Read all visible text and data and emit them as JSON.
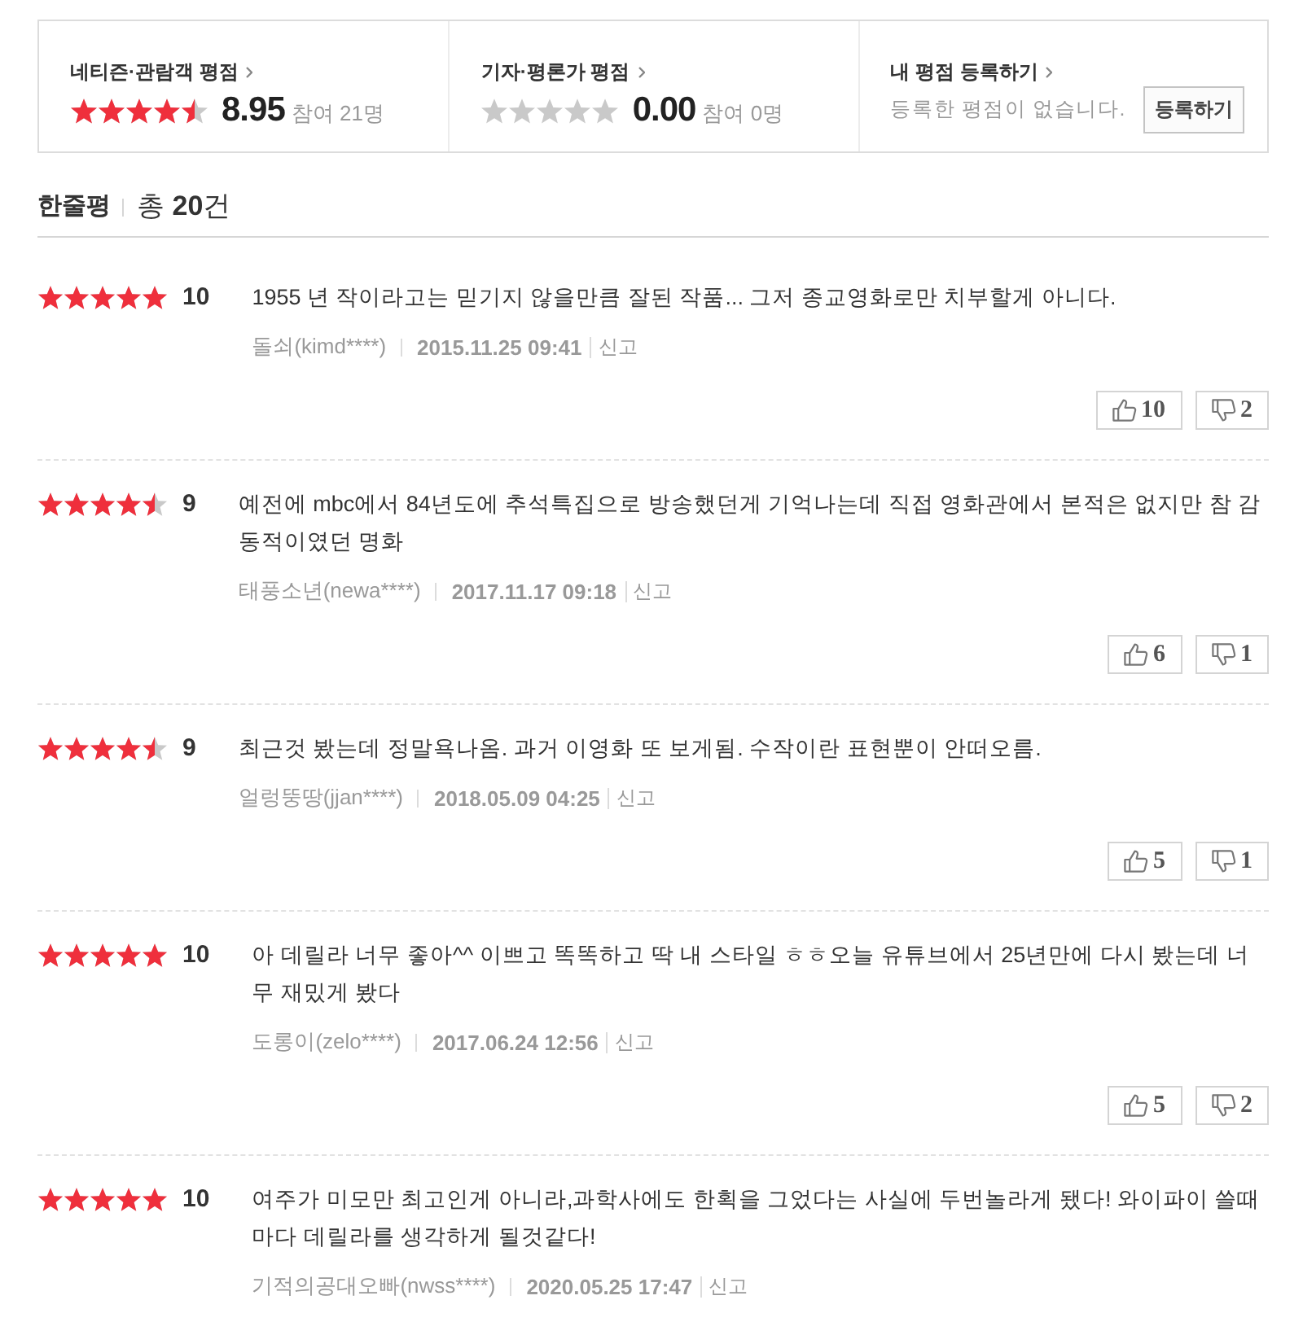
{
  "rating_summary": {
    "sections": [
      {
        "kind": "rating",
        "title": "네티즌·관람객 평점",
        "stars": 4.5,
        "score": "8.95",
        "participants": "참여 21명"
      },
      {
        "kind": "rating",
        "title": "기자·평론가 평점",
        "stars": 0,
        "score": "0.00",
        "participants": "참여 0명"
      },
      {
        "kind": "register",
        "title": "내 평점 등록하기",
        "message": "등록한 평점이 없습니다.",
        "button": "등록하기"
      }
    ]
  },
  "review_header": {
    "title": "한줄평",
    "count_text": "총 **20**건"
  },
  "reviews": [
    {
      "stars": 5,
      "score": "10",
      "text": "1955 년 작이라고는 믿기지 않을만큼 잘된 작품... 그저 종교영화로만 치부할게 아니다.",
      "author": "돌쇠(kimd****)",
      "date": "2015.11.25 09:41",
      "report": "신고",
      "likes": "10",
      "dislikes": "2"
    },
    {
      "stars": 4.5,
      "score": "9",
      "text": "예전에 mbc에서 84년도에 추석특집으로 방송했던게 기억나는데 직접 영화관에서 본적은 없지만 참 감동적이였던 명화",
      "author": "태풍소년(newa****)",
      "date": "2017.11.17 09:18",
      "report": "신고",
      "likes": "6",
      "dislikes": "1"
    },
    {
      "stars": 4.5,
      "score": "9",
      "text": "최근것 봤는데 정말욕나옴. 과거 이영화 또 보게됨. 수작이란 표현뿐이 안떠오름.",
      "author": "얼렁뚱땅(jjan****)",
      "date": "2018.05.09 04:25",
      "report": "신고",
      "likes": "5",
      "dislikes": "1"
    },
    {
      "stars": 5,
      "score": "10",
      "text": "아 데릴라 너무 좋아^^ 이쁘고 똑똑하고 딱 내 스타일 ㅎㅎ오늘 유튜브에서 25년만에 다시 봤는데 너무 재밌게 봤다",
      "author": "도롱이(zelo****)",
      "date": "2017.06.24 12:56",
      "report": "신고",
      "likes": "5",
      "dislikes": "2"
    },
    {
      "stars": 5,
      "score": "10",
      "text": "여주가 미모만 최고인게 아니라,과학사에도 한획을 그었다는 사실에 두번놀라게 됐다! 와이파이 쓸때마다 데릴라를 생각하게 될것같다!",
      "author": "기적의공대오빠(nwss****)",
      "date": "2020.05.25 17:47",
      "report": "신고"
    }
  ]
}
